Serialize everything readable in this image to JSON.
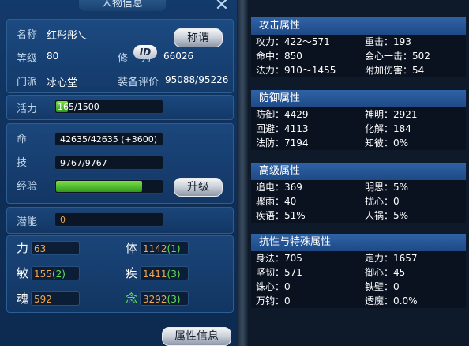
{
  "window": {
    "title": "人物信息"
  },
  "info": {
    "name_label": "名称",
    "name_value": "红彤彤乀",
    "id_badge": "ID",
    "title_button": "称谓",
    "level_label": "等级",
    "level_value": "80",
    "cultivation_label": "修    为",
    "cultivation_value": "66026",
    "sect_label": "门派",
    "sect_value": "冰心堂",
    "equip_label": "装备评价",
    "equip_value": "95088/95226",
    "vitality_label": "活力",
    "vitality_value": "165/1500",
    "vitality_fraction": 0.11
  },
  "stats": {
    "hp_label": "命",
    "hp_value": "42635/42635 (+3600)",
    "skill_label": "技",
    "skill_value": "9767/9767",
    "exp_label": "经验",
    "exp_fraction": 0.8,
    "upgrade_button": "升级",
    "potential_label": "潜能",
    "potential_value": "0"
  },
  "attributes": [
    {
      "label": "力",
      "base": "63",
      "bonus": ""
    },
    {
      "label": "体",
      "base": "1142",
      "bonus": "(1)"
    },
    {
      "label": "敏",
      "base": "155",
      "bonus": "(2)"
    },
    {
      "label": "疾",
      "base": "1411",
      "bonus": "(3)"
    },
    {
      "label": "魂",
      "base": "592",
      "bonus": ""
    },
    {
      "label": "念",
      "base": "3292",
      "bonus": "(3)"
    }
  ],
  "attr_info_button": "属性信息",
  "right": {
    "sections": [
      {
        "title": "攻击属性",
        "rows": [
          [
            "攻力：422～571",
            "重击：193"
          ],
          [
            "命中：850",
            "会心一击：502"
          ],
          [
            "法力：910～1455",
            "附加伤害：54"
          ]
        ]
      },
      {
        "title": "防御属性",
        "rows": [
          [
            "防御：4429",
            "神明：2921"
          ],
          [
            "回避：4113",
            "化解：184"
          ],
          [
            "法防：7194",
            "知彼：0%"
          ]
        ]
      },
      {
        "title": "高级属性",
        "rows": [
          [
            "追电：369",
            "明思：5%"
          ],
          [
            "骤雨：40",
            "扰心：0"
          ],
          [
            "疾语：51%",
            "人祸：5%"
          ]
        ]
      },
      {
        "title": "抗性与特殊属性",
        "rows": [
          [
            "身法：705",
            "定力：1657"
          ],
          [
            "坚韧：571",
            "御心：45"
          ],
          [
            "诛心：0",
            "铁壁：0"
          ],
          [
            "万钧：0",
            "透魔：0.0%"
          ]
        ]
      }
    ]
  }
}
